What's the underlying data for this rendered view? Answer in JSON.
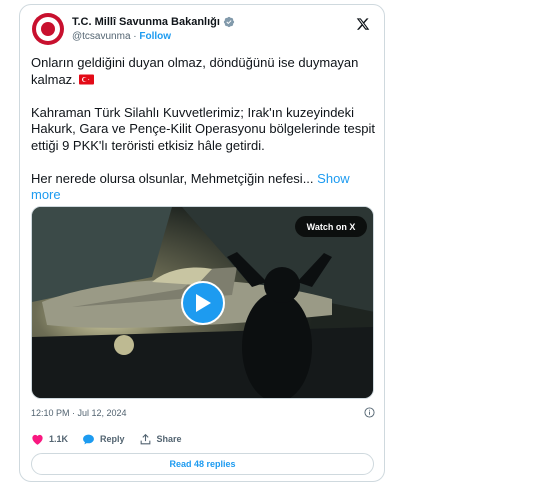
{
  "author": {
    "name": "T.C. Millî Savunma Bakanlığı",
    "handle": "@tcsavunma",
    "follow_label": "Follow"
  },
  "post": {
    "paragraph_1": "Onların geldiğini duyan olmaz, döndüğünü ise duymayan kalmaz.",
    "paragraph_2": "Kahraman Türk Silahlı Kuvvetlerimiz; Irak'ın kuzeyindeki Hakurk, Gara ve Pençe-Kilit Operasyonu bölgelerinde tespit ettiği 9 PKK'lı teröristi etkisiz hâle getirdi.",
    "paragraph_3": "Her nerede olursa olsunlar, Mehmetçiğin nefesi...",
    "show_more_label": "Show more",
    "flag_icon": "turkey-flag"
  },
  "media": {
    "watch_label": "Watch on X",
    "play_icon": "play-icon"
  },
  "meta": {
    "timestamp": "12:10 PM · Jul 12, 2024"
  },
  "actions": {
    "like_count": "1.1K",
    "reply_label": "Reply",
    "share_label": "Share"
  },
  "footer": {
    "read_replies_label": "Read 48 replies"
  },
  "colors": {
    "accent": "#1d9bf0",
    "like": "#f91880",
    "text": "#0f1419",
    "muted": "#536471",
    "border": "#cfd9de"
  }
}
